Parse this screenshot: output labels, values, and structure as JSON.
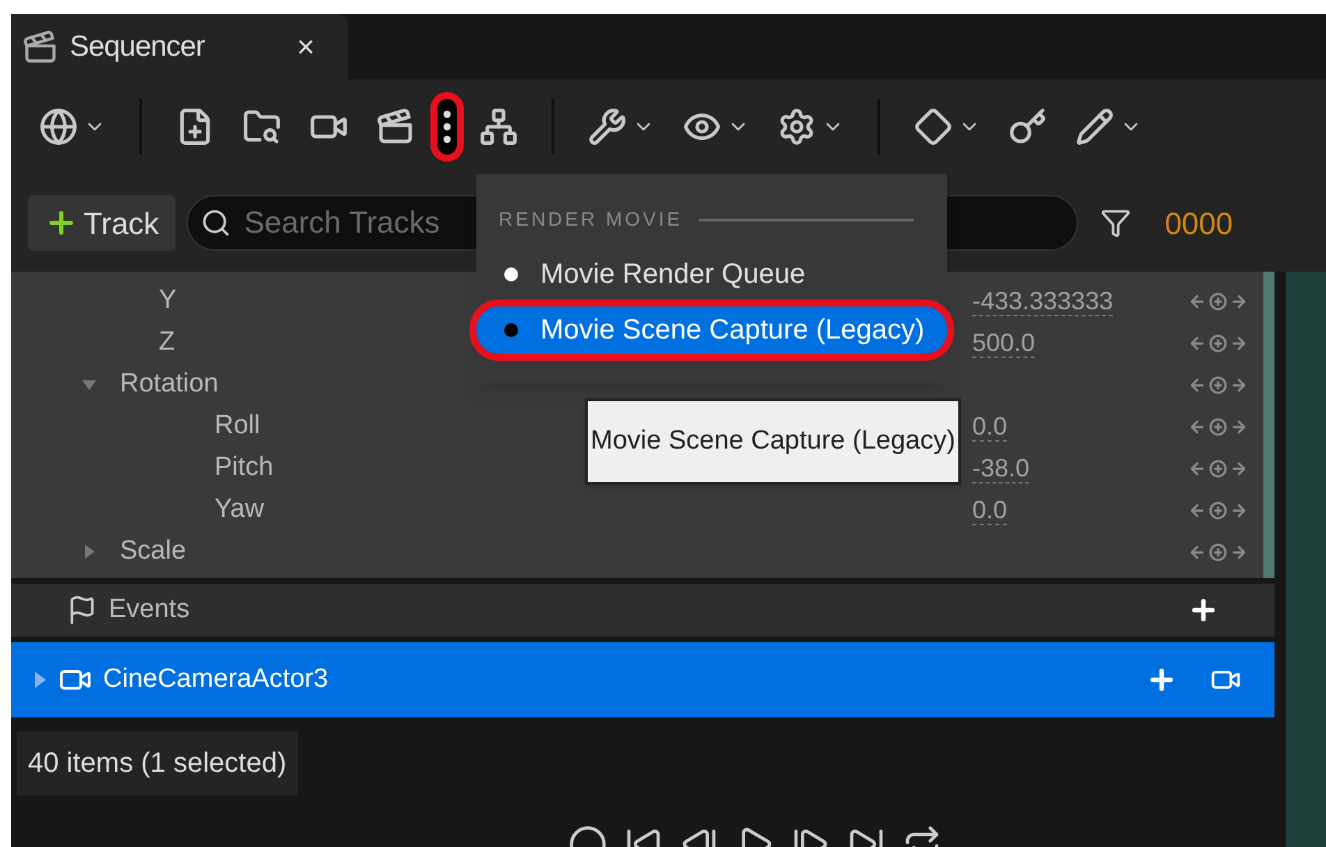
{
  "tab": {
    "title": "Sequencer",
    "close": "×"
  },
  "toolbar": [
    {
      "dropdown": true,
      "highlighted": false
    },
    {
      "dropdown": false,
      "highlighted": false
    },
    {
      "dropdown": false,
      "highlighted": false
    },
    {
      "dropdown": false,
      "highlighted": false
    },
    {
      "dropdown": false,
      "highlighted": false
    },
    {
      "dropdown": false,
      "highlighted": true
    },
    {
      "dropdown": false,
      "highlighted": false
    },
    {
      "dropdown": true,
      "highlighted": false
    },
    {
      "dropdown": true,
      "highlighted": false
    },
    {
      "dropdown": true,
      "highlighted": false
    },
    {
      "dropdown": true,
      "highlighted": false
    },
    {
      "dropdown": false,
      "highlighted": false
    },
    {
      "dropdown": true,
      "highlighted": false
    }
  ],
  "track_button": "Track",
  "search": {
    "placeholder": "Search Tracks"
  },
  "timecode": "0000",
  "properties": [
    {
      "label": "Y",
      "value": "-433.333333"
    },
    {
      "label": "Z",
      "value": "500.0"
    },
    {
      "label": "Rotation",
      "expanded": true,
      "children": [
        {
          "label": "Roll",
          "value": "0.0"
        },
        {
          "label": "Pitch",
          "value": "-38.0"
        },
        {
          "label": "Yaw",
          "value": "0.0"
        }
      ]
    },
    {
      "label": "Scale",
      "expanded": false
    }
  ],
  "tracks": [
    {
      "kind": "events",
      "label": "Events",
      "selected": false
    },
    {
      "kind": "camera",
      "label": "CineCameraActor3",
      "selected": true,
      "expanded": false
    }
  ],
  "status": "40 items (1 selected)",
  "menu": {
    "section": "RENDER MOVIE",
    "items": [
      {
        "label": "Movie Render Queue",
        "selected": false,
        "highlighted": false
      },
      {
        "label": "Movie Scene Capture (Legacy)",
        "selected": true,
        "highlighted": true
      }
    ]
  },
  "tooltip": "Movie Scene Capture (Legacy)"
}
